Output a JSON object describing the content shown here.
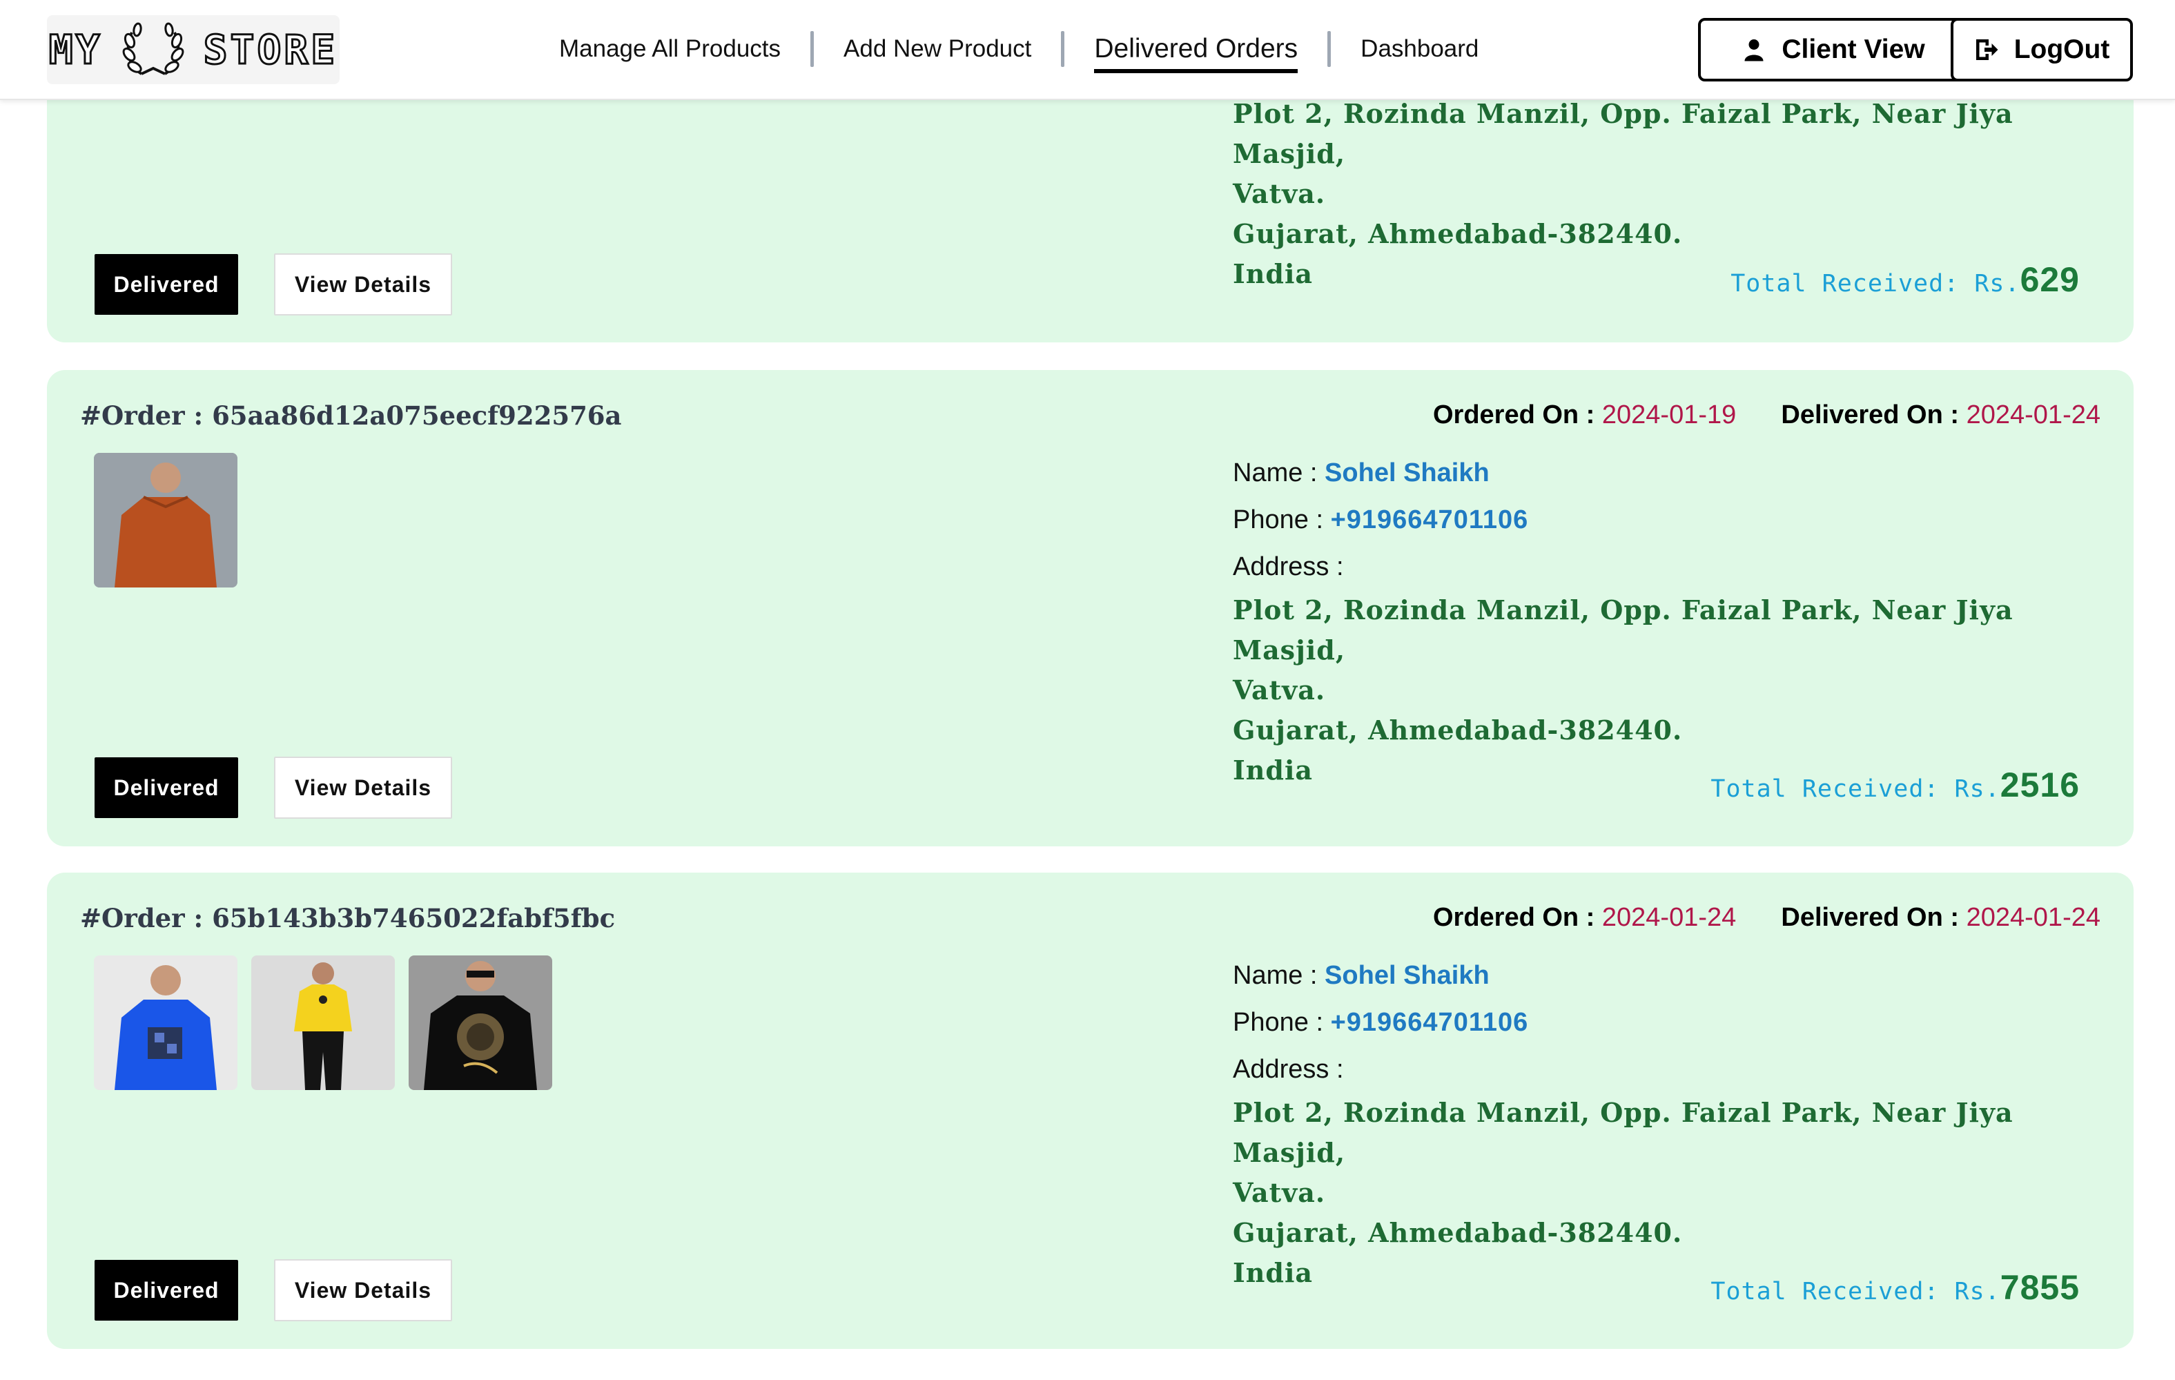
{
  "nav": {
    "logo": {
      "left": "MY",
      "right": "STORE"
    },
    "links": [
      "Manage All Products",
      "Add New Product",
      "Delivered Orders",
      "Dashboard"
    ],
    "active": "Delivered Orders",
    "client_view_label": "Client View",
    "logout_label": "LogOut"
  },
  "labels": {
    "order_prefix": "#Order : ",
    "ordered_on": "Ordered On : ",
    "delivered_on": "Delivered On : ",
    "name": "Name : ",
    "phone": "Phone : ",
    "address": "Address :",
    "total_received": "Total Received: Rs.",
    "status_button": "Delivered",
    "view_details": "View Details"
  },
  "orders": [
    {
      "address_lines": [
        "Plot 2, Rozinda Manzil, Opp. Faizal Park, Near Jiya Masjid,",
        "Vatva.",
        "Gujarat, Ahmedabad-382440.",
        "India"
      ],
      "total": "629"
    },
    {
      "id": "65aa86d12a075eecf922576a",
      "ordered_on": "2024-01-19",
      "delivered_on": "2024-01-24",
      "name": "Sohel Shaikh",
      "phone": "+919664701106",
      "address_lines": [
        "Plot 2, Rozinda Manzil, Opp. Faizal Park, Near Jiya Masjid,",
        "Vatva.",
        "Gujarat, Ahmedabad-382440.",
        "India"
      ],
      "products": [
        "orange t-shirt"
      ],
      "total": "2516"
    },
    {
      "id": "65b143b3b7465022fabf5fbc",
      "ordered_on": "2024-01-24",
      "delivered_on": "2024-01-24",
      "name": "Sohel Shaikh",
      "phone": "+919664701106",
      "address_lines": [
        "Plot 2, Rozinda Manzil, Opp. Faizal Park, Near Jiya Masjid,",
        "Vatva.",
        "Gujarat, Ahmedabad-382440.",
        "India"
      ],
      "products": [
        "blue printed t-shirt",
        "yellow t-shirt",
        "black graphic t-shirt"
      ],
      "total": "7855"
    }
  ],
  "colors": {
    "card_bg": "#dff9e6",
    "date_value": "#b0174a",
    "name_phone": "#1f7ac2",
    "address": "#1e6a33",
    "total_label": "#1b9fd6",
    "total_amount": "#1c7a3a"
  }
}
